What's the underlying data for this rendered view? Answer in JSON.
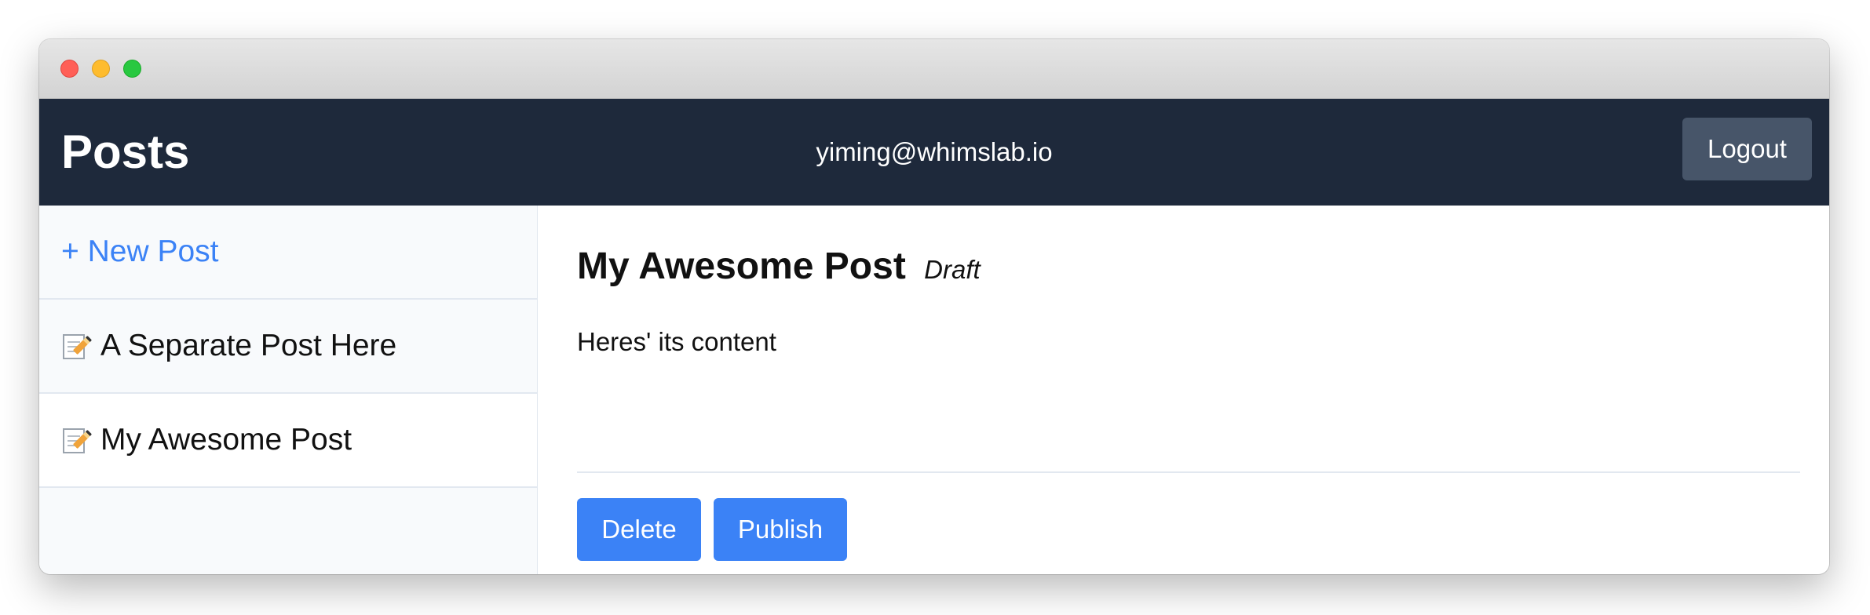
{
  "header": {
    "title": "Posts",
    "user_email": "yiming@whimslab.io",
    "logout_label": "Logout"
  },
  "sidebar": {
    "new_post_label": "+ New Post",
    "items": [
      {
        "label": "A Separate Post Here",
        "icon": "memo-icon",
        "active": false
      },
      {
        "label": "My Awesome Post",
        "icon": "memo-icon",
        "active": true
      }
    ]
  },
  "post": {
    "title": "My Awesome Post",
    "status": "Draft",
    "content": "Heres' its content",
    "delete_label": "Delete",
    "publish_label": "Publish"
  },
  "colors": {
    "header_bg": "#1e293b",
    "logout_bg": "#475569",
    "accent_blue": "#3b82f6",
    "sidebar_bg": "#f8fafc",
    "border": "#e2e8f0"
  }
}
